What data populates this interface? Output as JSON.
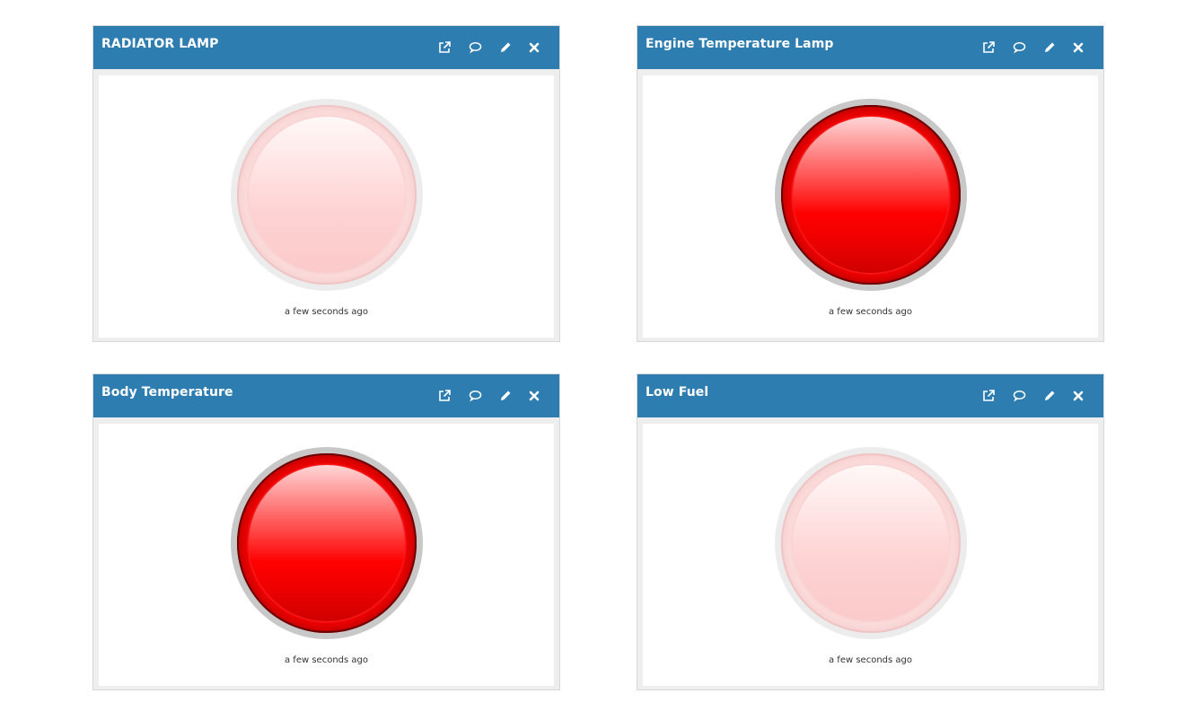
{
  "widgets": [
    {
      "title": "RADIATOR LAMP",
      "state": "off",
      "timestamp": "a few seconds ago"
    },
    {
      "title": "Engine Temperature Lamp",
      "state": "on",
      "timestamp": "a few seconds ago"
    },
    {
      "title": "Body Temperature",
      "state": "on",
      "timestamp": "a few seconds ago"
    },
    {
      "title": "Low Fuel",
      "state": "off",
      "timestamp": "a few seconds ago"
    }
  ],
  "toolbar_icons": [
    "external-link-icon",
    "comment-icon",
    "pencil-icon",
    "close-icon"
  ],
  "colors": {
    "header": "#2e7db1",
    "lamp_on": "#ff0000",
    "lamp_off": "#fbdada",
    "panel_bg": "#eeeeee"
  }
}
